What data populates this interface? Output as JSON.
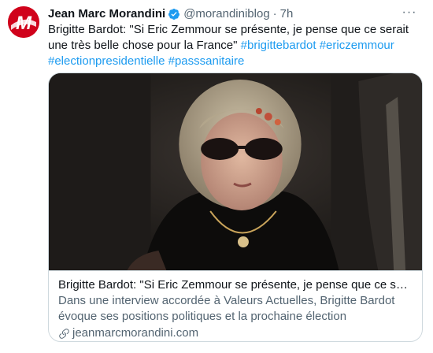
{
  "author": {
    "name": "Jean Marc Morandini",
    "handle": "@morandiniblog",
    "separator": "·",
    "time": "7h",
    "avatar_letter": "M"
  },
  "more_label": "···",
  "tweet": {
    "text": "Brigitte Bardot: \"Si Eric Zemmour se présente, je pense que ce serait une très belle chose pour la France\"",
    "hashtags": [
      "#brigittebardot",
      "#ericzemmour",
      "#electionpresidentielle",
      "#passsanitaire"
    ]
  },
  "card": {
    "title": "Brigitte Bardot: \"Si Eric Zemmour se présente, je pense que ce serait une très belle chose pour la France\"",
    "description": "Dans une interview accordée à Valeurs Actuelles, Brigitte Bardot évoque ses positions politiques et la prochaine élection présidentielle. \"Je voter...",
    "domain": "jeanmarcmorandini.com"
  },
  "colors": {
    "accent": "#1d9bf0",
    "secondary_text": "#536471",
    "brand": "#d0021b"
  }
}
